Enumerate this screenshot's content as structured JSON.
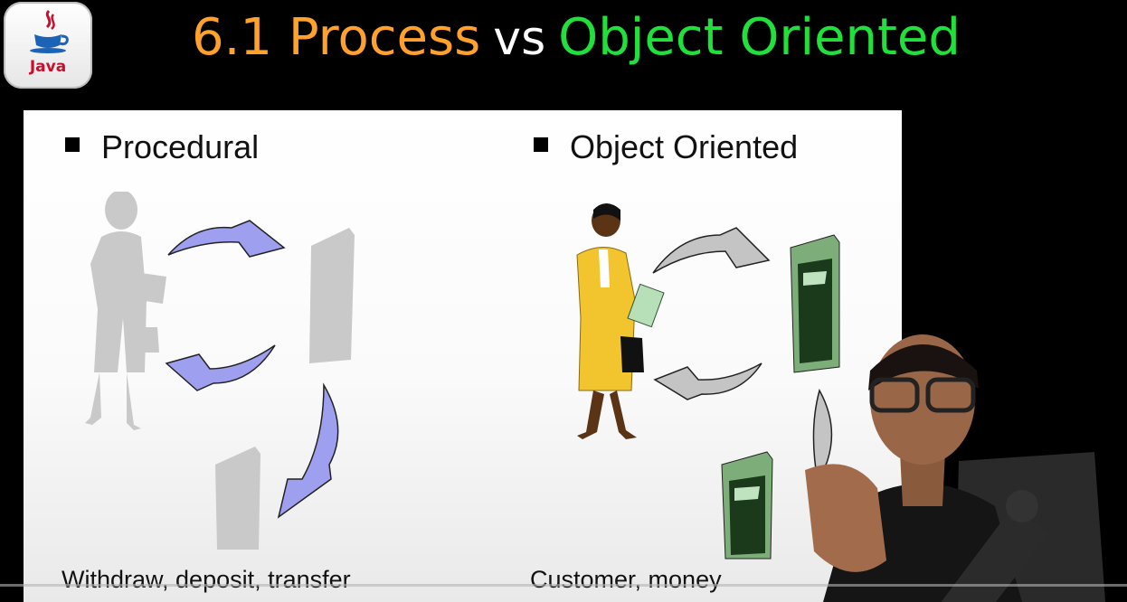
{
  "header": {
    "logo_text": "Java",
    "title_part1": "6.1 Process",
    "title_part2": "vs",
    "title_part3": "Object Oriented"
  },
  "colors": {
    "title_part1": "#ffa12c",
    "title_part2": "#ffffff",
    "title_part3": "#22e03b",
    "arrow_procedural": "#9f9ff0",
    "arrow_object": "#c4c4c4"
  },
  "slide": {
    "procedural": {
      "heading": "Procedural",
      "caption": "Withdraw, deposit, transfer"
    },
    "object_oriented": {
      "heading": "Object Oriented",
      "caption": "Customer, money"
    }
  }
}
